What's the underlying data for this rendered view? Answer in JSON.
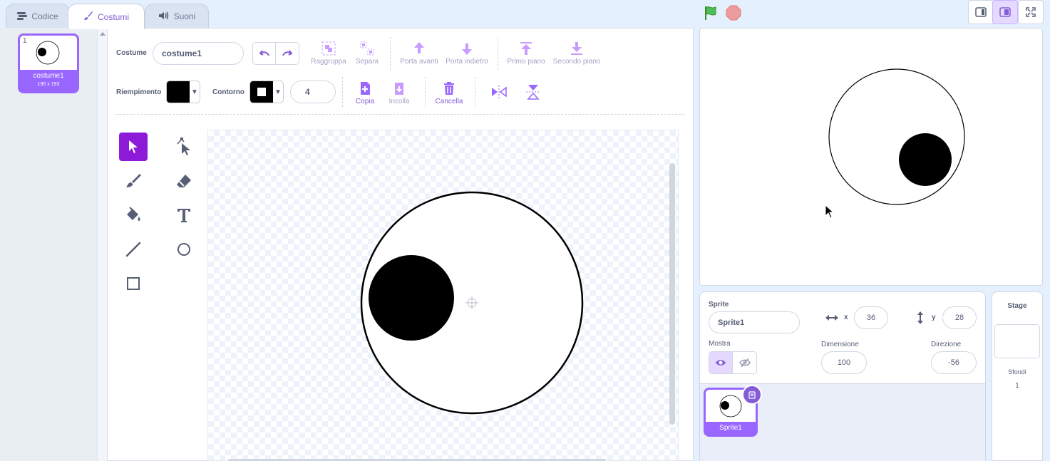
{
  "tabs": [
    {
      "label": "Codice",
      "icon": "code-icon"
    },
    {
      "label": "Costumi",
      "icon": "brush-icon"
    },
    {
      "label": "Suoni",
      "icon": "speaker-icon"
    }
  ],
  "active_tab": "Costumi",
  "costume_list": {
    "items": [
      {
        "number": "1",
        "name": "costume1",
        "size": "190 x 193"
      }
    ]
  },
  "editor": {
    "costume_label": "Costume",
    "costume_name": "costume1",
    "toolbar": {
      "group": "Raggruppa",
      "ungroup": "Separa",
      "forward": "Porta avanti",
      "backward": "Porta indietro",
      "front": "Primo piano",
      "back": "Secondo piano"
    },
    "fill_label": "Riempimento",
    "fill_color": "#000000",
    "outline_label": "Contorno",
    "outline_color": "#000000",
    "outline_width": "4",
    "copy": "Copia",
    "paste": "Incolla",
    "delete": "Cancella"
  },
  "sprite_info": {
    "sprite_label": "Sprite",
    "sprite_name": "Sprite1",
    "x_label": "x",
    "x_value": "36",
    "y_label": "y",
    "y_value": "28",
    "show_label": "Mostra",
    "size_label": "Dimensione",
    "size_value": "100",
    "direction_label": "Direzione",
    "direction_value": "-56"
  },
  "sprites": [
    {
      "name": "Sprite1"
    }
  ],
  "stage_panel": {
    "title": "Stage",
    "backdrops_label": "Sfondi",
    "backdrops_count": "1"
  },
  "colors": {
    "accent": "#855cd6",
    "selected_tool": "#8c1ad8",
    "tile": "#9966ff"
  }
}
